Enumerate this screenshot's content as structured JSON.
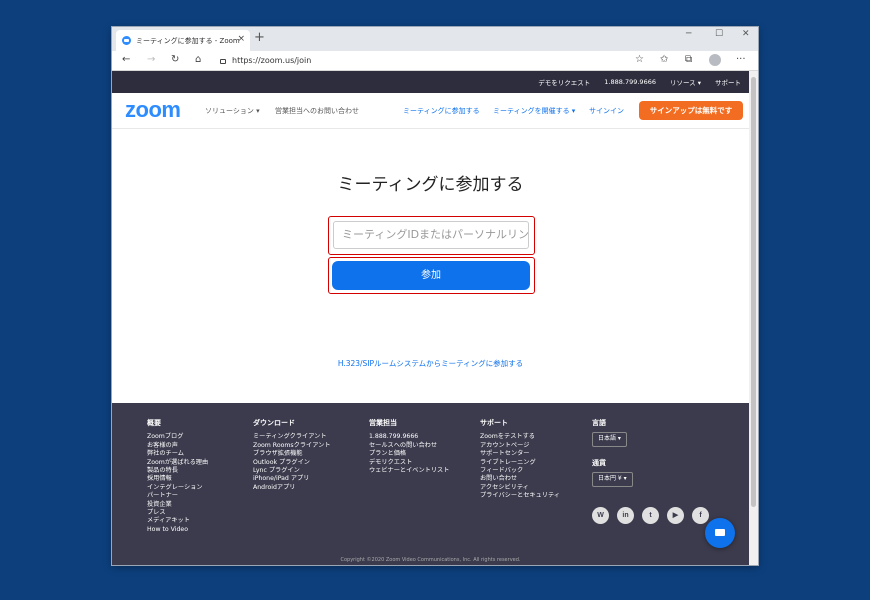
{
  "browser": {
    "tab_title": "ミーティングに参加する - Zoom",
    "tab_close": "×",
    "new_tab": "+",
    "url": "https://zoom.us/join",
    "win_minimize": "─",
    "win_maximize": "☐",
    "win_close": "✕",
    "nav_back": "←",
    "nav_forward": "→",
    "nav_refresh": "↻",
    "nav_home": "⌂",
    "star": "☆",
    "favorites": "✩",
    "collections": "⧉",
    "more": "···"
  },
  "topbar": {
    "request_demo": "デモをリクエスト",
    "phone": "1.888.799.9666",
    "resources": "リソース ▾",
    "support": "サポート"
  },
  "nav": {
    "logo": "zoom",
    "solutions": "ソリューション ▾",
    "contact_sales": "営業担当へのお問い合わせ",
    "join_meeting": "ミーティングに参加する",
    "host_meeting": "ミーティングを開催する ▾",
    "sign_in": "サインイン",
    "sign_up": "サインアップは無料です"
  },
  "main": {
    "heading": "ミーティングに参加する",
    "input_placeholder": "ミーティングIDまたはパーソナルリンク名",
    "join_button": "参加",
    "h323_link": "H.323/SIPルームシステムからミーティングに参加する"
  },
  "footer": {
    "about": {
      "title": "概要",
      "items": [
        "Zoomブログ",
        "お客様の声",
        "弊社のチーム",
        "Zoomが選ばれる理由",
        "製品の特長",
        "採用情報",
        "インテグレーション",
        "パートナー",
        "投資企業",
        "プレス",
        "メディアキット",
        "How to Video"
      ]
    },
    "download": {
      "title": "ダウンロード",
      "items": [
        "ミーティングクライアント",
        "Zoom Roomsクライアント",
        "ブラウザ拡張機能",
        "Outlook プラグイン",
        "Lync プラグイン",
        "iPhone/iPad アプリ",
        "Androidアプリ"
      ]
    },
    "sales": {
      "title": "営業担当",
      "items": [
        "1.888.799.9666",
        "セールスへの問い合わせ",
        "プランと価格",
        "デモリクエスト",
        "ウェビナーとイベントリスト"
      ]
    },
    "support": {
      "title": "サポート",
      "items": [
        "Zoomをテストする",
        "アカウントページ",
        "サポートセンター",
        "ライブトレーニング",
        "フィードバック",
        "お問い合わせ",
        "アクセシビリティ",
        "プライバシーとセキュリティ"
      ]
    },
    "language_title": "言語",
    "language_value": "日本語 ▾",
    "currency_title": "通貨",
    "currency_value": "日本円 ¥ ▾",
    "copyright": "Copyright ©2020 Zoom Video Communications, Inc. All rights reserved."
  },
  "social": [
    "W",
    "in",
    "t",
    "▶",
    "f"
  ]
}
